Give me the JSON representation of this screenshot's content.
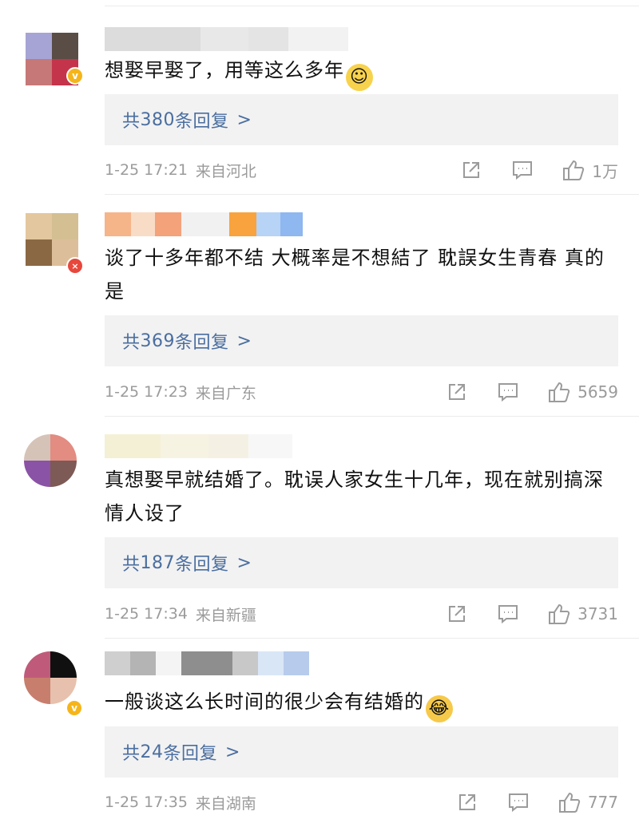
{
  "comments": [
    {
      "text": "想娶早娶了，用等这么多年",
      "emoji": "smile",
      "reply_total": "共",
      "reply_count": "380",
      "reply_suffix": "条回复",
      "time": "1-25 17:21",
      "location": "来自河北",
      "likes": "1万",
      "avatar_colors": [
        "#a6a4d4",
        "#5a4d45",
        "#c67878",
        "#c4344a"
      ],
      "badge": "vip",
      "name_colors": [
        "#dcdcdc",
        "#e8e8e8",
        "#e4e4e4",
        "#f2f2f2"
      ]
    },
    {
      "text": "谈了十多年都不结 大概率是不想結了 耽誤女生青春 真的是",
      "emoji": "",
      "reply_total": "共",
      "reply_count": "369",
      "reply_suffix": "条回复",
      "time": "1-25 17:23",
      "location": "来自广东",
      "likes": "5659",
      "avatar_colors": [
        "#e3c79e",
        "#d4bf93",
        "#8b6844",
        "#dcbf9a"
      ],
      "badge": "red",
      "name_colors": [
        "#f6b489",
        "#f9dcc6",
        "#f3a27a",
        "#f1f1f1",
        "#f8a33e",
        "#b7d3f6",
        "#8fb7f0"
      ]
    },
    {
      "text": "真想娶早就结婚了。耽误人家女生十几年，现在就别搞深情人设了",
      "emoji": "",
      "reply_total": "共",
      "reply_count": "187",
      "reply_suffix": "条回复",
      "time": "1-25 17:34",
      "location": "来自新疆",
      "likes": "3731",
      "avatar_colors": [
        "#d6c3b8",
        "#e28c82",
        "#8a53a6",
        "#7d5a55"
      ],
      "badge": "",
      "name_colors": [
        "#f4f0d6",
        "#f6f3e2",
        "#f4f1e4",
        "#f7f7f7"
      ]
    },
    {
      "text": "一般谈这么长时间的很少会有结婚的",
      "emoji": "laugh",
      "reply_total": "共",
      "reply_count": "24",
      "reply_suffix": "条回复",
      "time": "1-25 17:35",
      "location": "来自湖南",
      "likes": "777",
      "avatar_colors": [
        "#c05a7a",
        "#101010",
        "#c77e6d",
        "#e7c1ad"
      ],
      "badge": "vip",
      "name_colors": [
        "#cfcfcf",
        "#b4b4b4",
        "#f4f4f4",
        "#8e8e8e",
        "#c8c8c8",
        "#d9e6f6",
        "#b7ccec"
      ]
    }
  ],
  "reply_arrow": ">",
  "colors": {
    "reply_link": "#4a6ea0",
    "meta_gray": "#9b9b9b",
    "reply_box_bg": "#f2f2f2",
    "vip_badge": "#f5b51a"
  }
}
